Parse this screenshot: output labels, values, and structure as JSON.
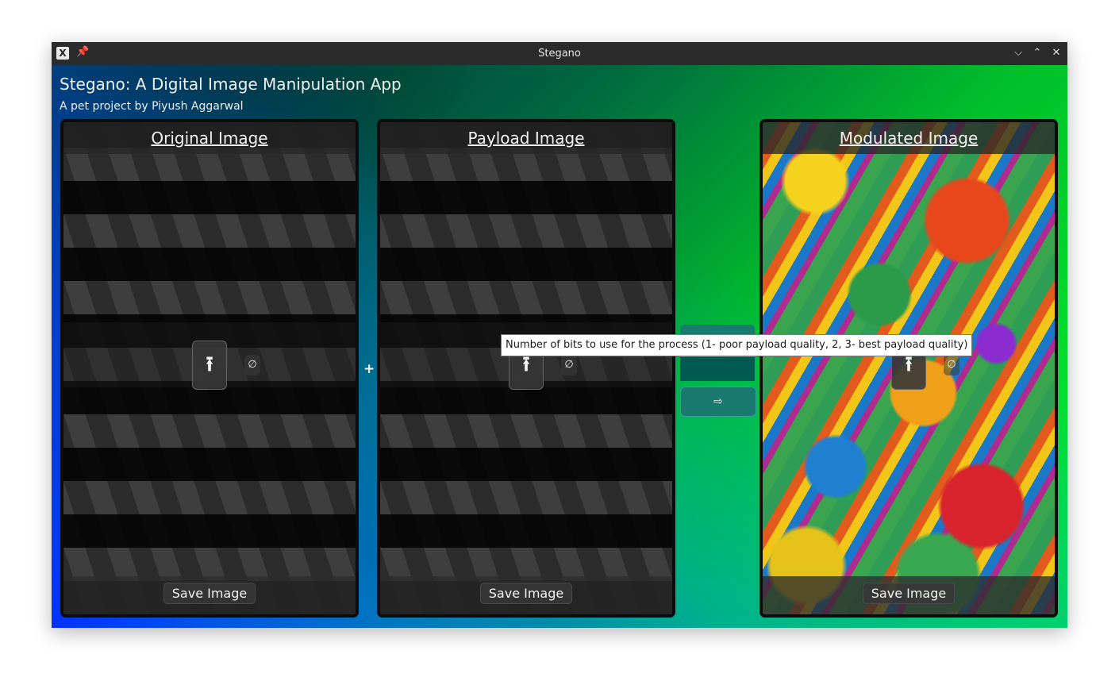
{
  "window": {
    "title": "Stegano",
    "controls": {
      "minimize": "⌵",
      "maximize": "⌃",
      "close": "✕"
    }
  },
  "app": {
    "title": "Stegano: A Digital Image Manipulation App",
    "subtitle": "A pet project by Piyush Aggarwal"
  },
  "panels": {
    "original": {
      "title": "Original Image",
      "save": "Save Image",
      "upload": "⭱",
      "clear": "∅"
    },
    "payload": {
      "title": "Payload Image",
      "save": "Save Image",
      "upload": "⭱",
      "clear": "∅"
    },
    "modulated": {
      "title": "Modulated Image",
      "save": "Save Image",
      "upload": "⭱",
      "clear": "∅"
    }
  },
  "operator": "+",
  "controls": {
    "process_arrow": "⇨",
    "tooltip": "Number of bits to use for the process (1- poor payload quality, 2, 3- best payload quality)"
  },
  "icons": {
    "app": "x11-app-icon",
    "pin": "pin-icon",
    "upload": "upload-icon",
    "clear": "clear-icon"
  }
}
